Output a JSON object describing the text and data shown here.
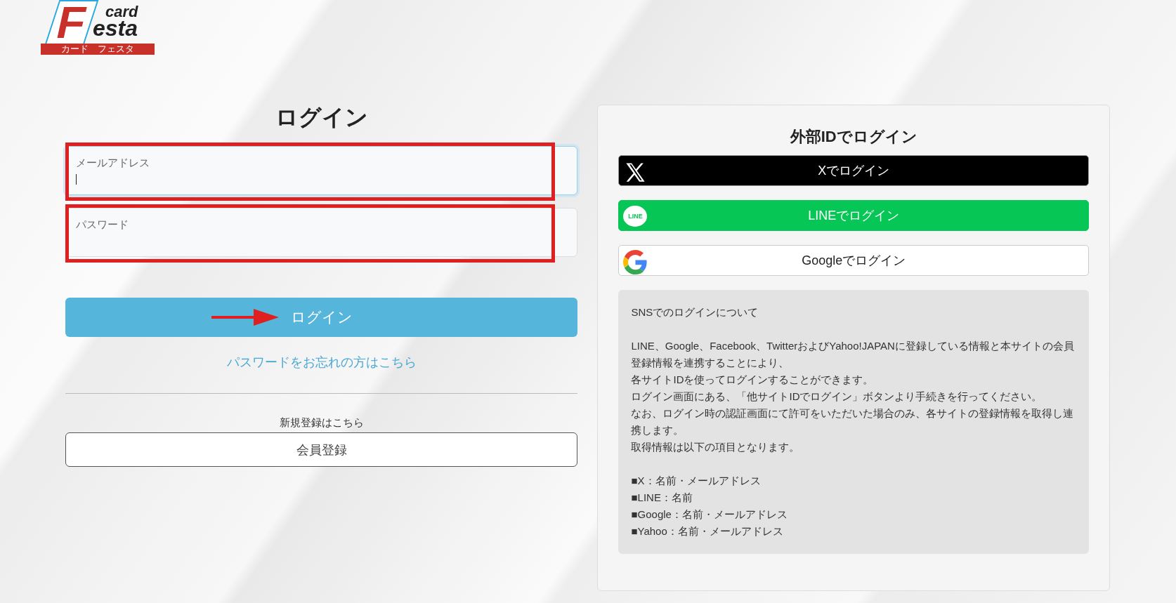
{
  "logo": {
    "letter": "F",
    "word_top": "card",
    "word_bottom": "esta",
    "subtitle": "カード　フェスタ"
  },
  "login": {
    "title": "ログイン",
    "fields": [
      {
        "label": "メールアドレス",
        "focused": true,
        "annotated": true
      },
      {
        "label": "パスワード",
        "focused": false,
        "annotated": true
      }
    ],
    "submit": {
      "label": "ログイン",
      "annotated": true
    },
    "forgot_link": "パスワードをお忘れの方はこちら",
    "register_caption": "新規登録はこちら",
    "register_button": "会員登録"
  },
  "external": {
    "title": "外部IDでログイン",
    "buttons": [
      {
        "kind": "x",
        "label": "Xでログイン"
      },
      {
        "kind": "line",
        "label": "LINEでログイン",
        "icon_text": "LINE"
      },
      {
        "kind": "google",
        "label": "Googleでログイン"
      }
    ],
    "info": {
      "heading": "SNSでのログインについて",
      "lines": [
        "LINE、Google、Facebook、TwitterおよびYahoo!JAPANに登録している情報と本サイトの会員登録情報を連携することにより、",
        "各サイトIDを使ってログインすることができます。",
        "ログイン画面にある、「他サイトIDでログイン」ボタンより手続きを行ってください。",
        "なお、ログイン時の認証画面にて許可をいただいた場合のみ、各サイトの登録情報を取得し連携します。",
        "取得情報は以下の項目となります。"
      ],
      "items": [
        "■X：名前・メールアドレス",
        "■LINE：名前",
        "■Google：名前・メールアドレス",
        "■Yahoo：名前・メールアドレス"
      ]
    }
  }
}
